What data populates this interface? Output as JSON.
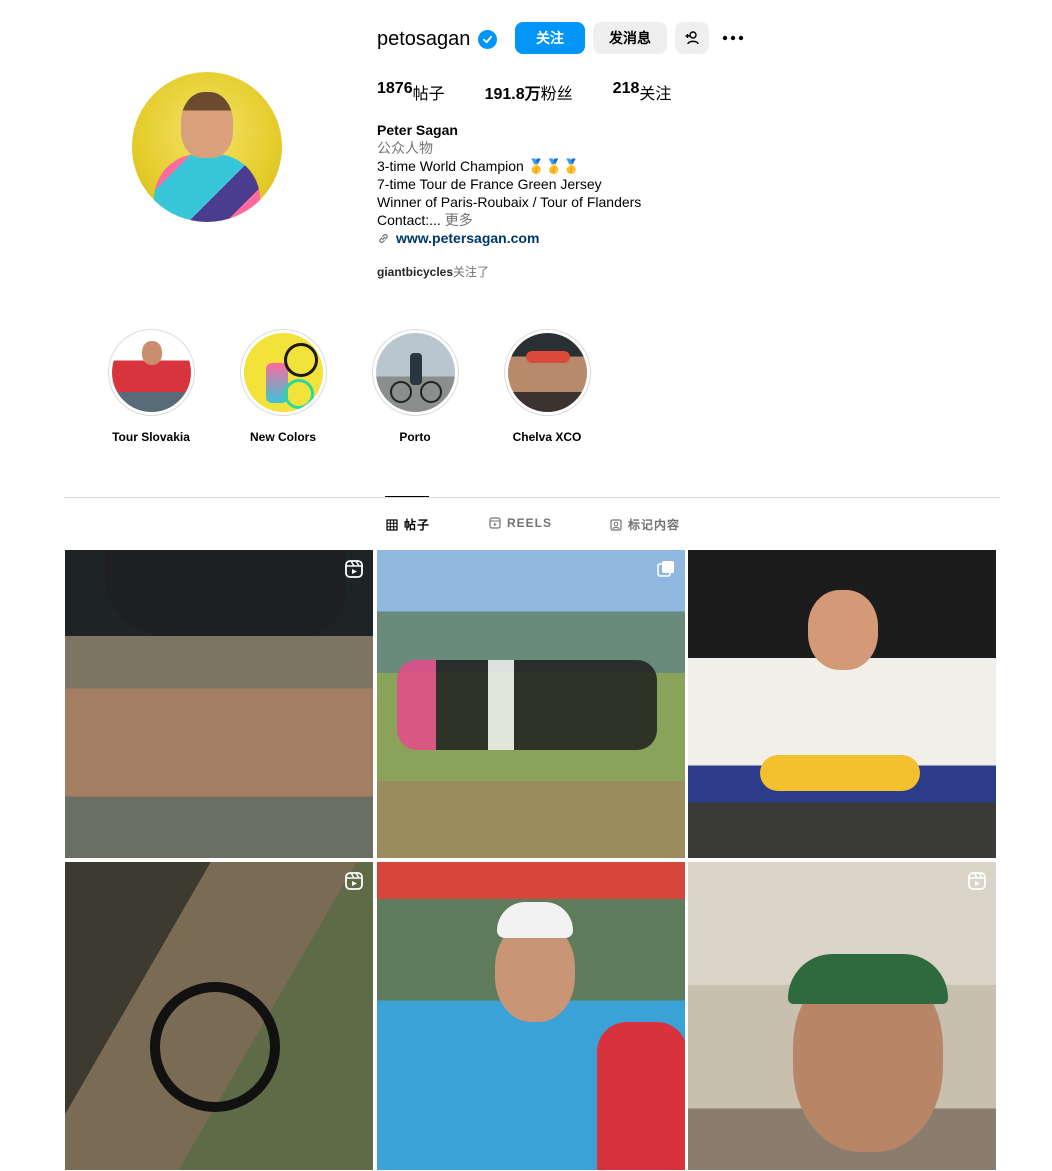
{
  "profile": {
    "username": "petosagan",
    "follow_label": "关注",
    "message_label": "发消息",
    "stats": {
      "posts_value": "1876",
      "posts_label": "帖子",
      "followers_value": "191.8万",
      "followers_label": "粉丝",
      "following_value": "218",
      "following_label": "关注"
    },
    "bio": {
      "name": "Peter Sagan",
      "category": "公众人物",
      "line1": "3-time World Champion 🥇🥇🥇",
      "line2": "7-time Tour de France Green Jersey",
      "line3": "Winner of Paris-Roubaix / Tour of Flanders",
      "line4": "Contact:...",
      "more": "更多",
      "link": "www.petersagan.com"
    },
    "followed_by_user": "giantbicycles",
    "followed_by_suffix": "关注了"
  },
  "highlights": [
    {
      "label": "Tour Slovakia"
    },
    {
      "label": "New Colors"
    },
    {
      "label": "Porto"
    },
    {
      "label": "Chelva XCO"
    }
  ],
  "tabs": [
    {
      "label": "帖子"
    },
    {
      "label": "REELS"
    },
    {
      "label": "标记内容"
    }
  ],
  "colors": {
    "accent": "#0095f6",
    "link": "#00376b",
    "secondary_text": "#737373",
    "button_gray": "#efefef"
  }
}
